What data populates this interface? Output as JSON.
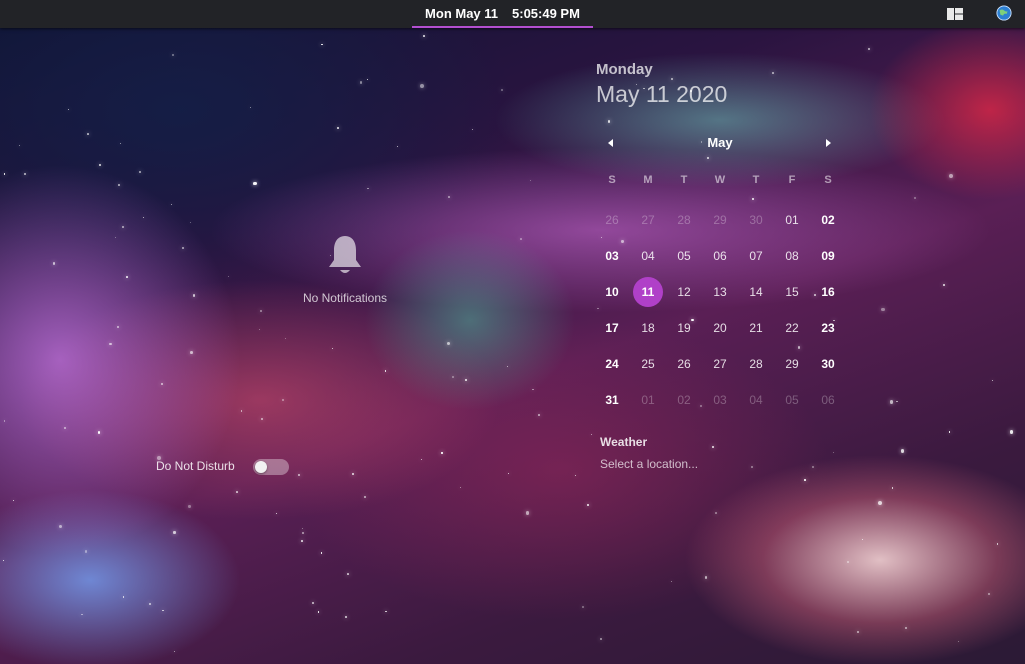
{
  "topbar": {
    "clock_date": "Mon May 11",
    "clock_time": "5:05:49 PM",
    "accent_color": "#b34fd0",
    "tray_icons": [
      "window-layout-icon",
      "globe-icon"
    ]
  },
  "notifications": {
    "empty_label": "No Notifications",
    "icon": "bell-icon",
    "dnd_label": "Do Not Disturb",
    "dnd_enabled": false
  },
  "date_header": {
    "weekday": "Monday",
    "full_date": "May 11 2020"
  },
  "calendar": {
    "month": "May",
    "weekday_headers": [
      "S",
      "M",
      "T",
      "W",
      "T",
      "F",
      "S"
    ],
    "today": "11",
    "today_color": "#b040c8",
    "weeks": [
      [
        "26",
        "27",
        "28",
        "29",
        "30",
        "01",
        "02"
      ],
      [
        "03",
        "04",
        "05",
        "06",
        "07",
        "08",
        "09"
      ],
      [
        "10",
        "11",
        "12",
        "13",
        "14",
        "15",
        "16"
      ],
      [
        "17",
        "18",
        "19",
        "20",
        "21",
        "22",
        "23"
      ],
      [
        "24",
        "25",
        "26",
        "27",
        "28",
        "29",
        "30"
      ],
      [
        "31",
        "01",
        "02",
        "03",
        "04",
        "05",
        "06"
      ]
    ],
    "other_month_mask": [
      [
        true,
        true,
        true,
        true,
        true,
        false,
        false
      ],
      [
        false,
        false,
        false,
        false,
        false,
        false,
        false
      ],
      [
        false,
        false,
        false,
        false,
        false,
        false,
        false
      ],
      [
        false,
        false,
        false,
        false,
        false,
        false,
        false
      ],
      [
        false,
        false,
        false,
        false,
        false,
        false,
        false
      ],
      [
        false,
        true,
        true,
        true,
        true,
        true,
        true
      ]
    ]
  },
  "weather": {
    "title": "Weather",
    "location_prompt": "Select a location..."
  }
}
